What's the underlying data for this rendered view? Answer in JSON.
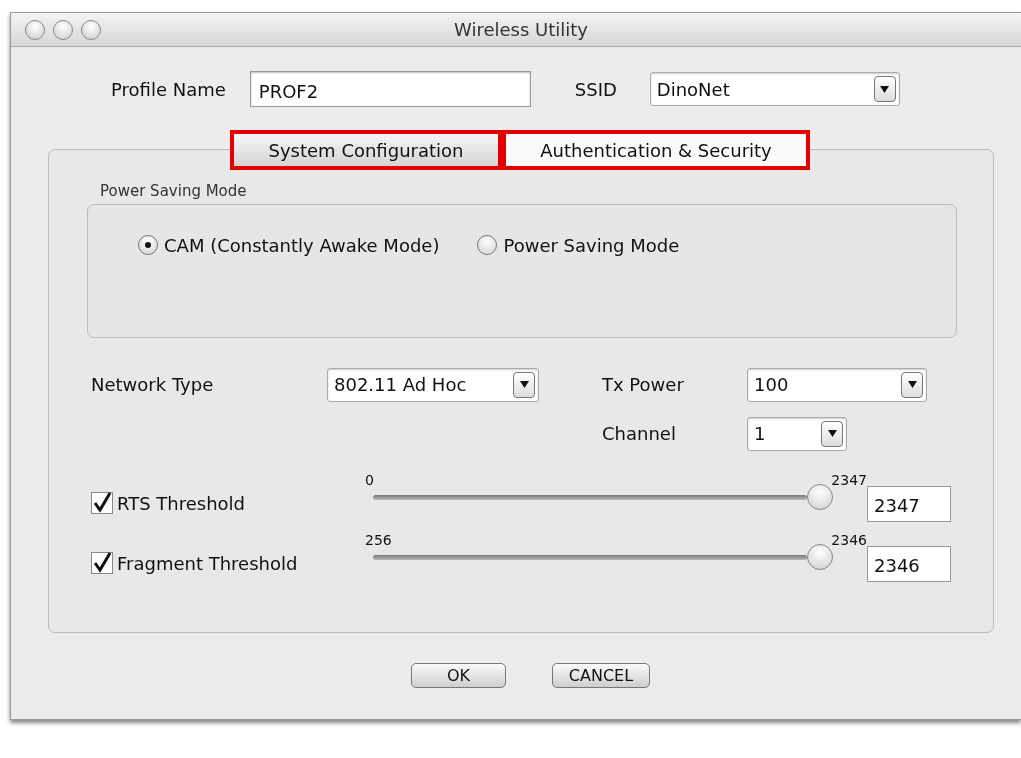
{
  "window": {
    "title": "Wireless Utility"
  },
  "profile_name": {
    "label": "Profile Name",
    "value": "PROF2"
  },
  "ssid": {
    "label": "SSID",
    "value": "DinoNet"
  },
  "tabs": [
    {
      "label": "System Configuration",
      "selected": true,
      "highlighted": true
    },
    {
      "label": "Authentication & Security",
      "selected": false,
      "highlighted": true
    }
  ],
  "power_saving_mode": {
    "title": "Power Saving Mode",
    "options": [
      {
        "label": "CAM (Constantly Awake Mode)",
        "selected": true
      },
      {
        "label": "Power Saving Mode",
        "selected": false
      }
    ]
  },
  "network_type": {
    "label": "Network Type",
    "value": "802.11 Ad Hoc"
  },
  "tx_power": {
    "label": "Tx Power",
    "value": "100"
  },
  "channel": {
    "label": "Channel",
    "value": "1"
  },
  "thresholds": [
    {
      "label": "RTS Threshold",
      "checked": true,
      "min": "0",
      "max": "2347",
      "level": 1,
      "value": "2347"
    },
    {
      "label": "Fragment Threshold",
      "checked": true,
      "min": "256",
      "max": "2346",
      "level": 1,
      "value": "2346"
    }
  ],
  "buttons": [
    {
      "label": "OK"
    },
    {
      "label": "CANCEL"
    }
  ]
}
